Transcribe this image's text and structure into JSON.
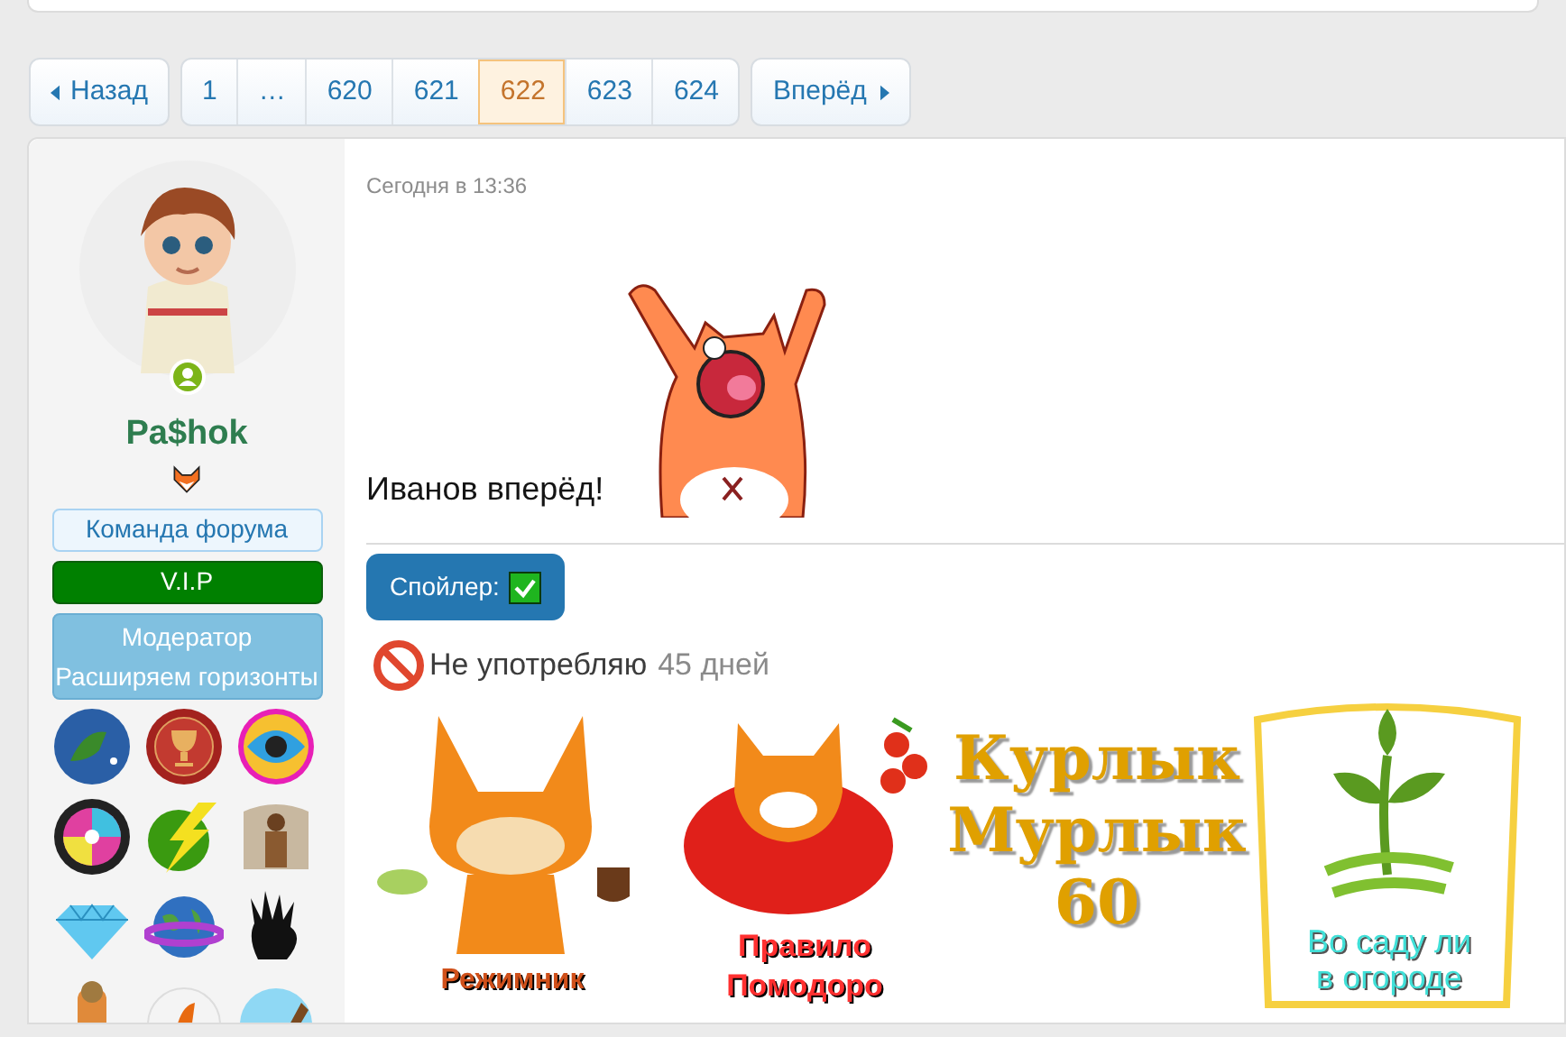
{
  "pagination": {
    "prev_label": "Назад",
    "next_label": "Вперёд",
    "pages": [
      {
        "label": "1",
        "selected": false
      },
      {
        "label": "…",
        "selected": false
      },
      {
        "label": "620",
        "selected": false
      },
      {
        "label": "621",
        "selected": false
      },
      {
        "label": "622",
        "selected": true
      },
      {
        "label": "623",
        "selected": false
      },
      {
        "label": "624",
        "selected": false
      }
    ]
  },
  "author": {
    "name": "Pa$hok",
    "banners": [
      {
        "text": "Команда форума",
        "kind": "outline"
      },
      {
        "text": "V.I.P",
        "kind": "green"
      },
      {
        "text": "Модератор Расширяем горизонты",
        "kind": "blue"
      }
    ]
  },
  "post": {
    "date": "Сегодня в 13:36",
    "text": "Иванов вперёд!",
    "spoiler_label": "Спойлер:"
  },
  "signature": {
    "counter": {
      "label": "Не употребляю",
      "value": "45 дней"
    },
    "stickers": [
      {
        "kind": "fox",
        "lines": [
          "Режимник"
        ]
      },
      {
        "kind": "tomato",
        "lines": [
          "Правило",
          "Помодоро"
        ]
      },
      {
        "kind": "rainbow",
        "lines": [
          "Курлык",
          "Мурлык",
          "60"
        ]
      },
      {
        "kind": "garden",
        "lines": [
          "Во саду ли",
          "в огороде"
        ]
      }
    ]
  }
}
